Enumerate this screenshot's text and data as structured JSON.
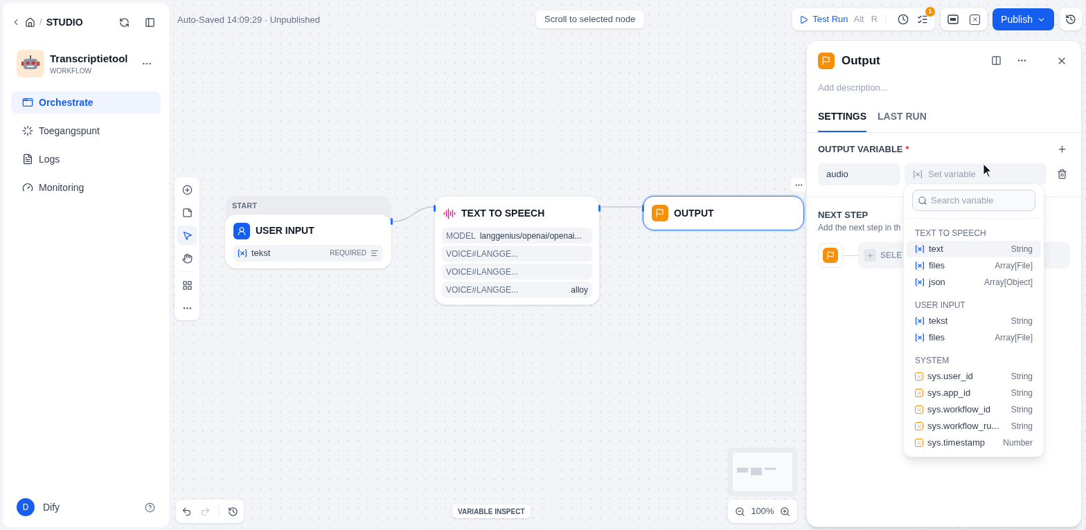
{
  "sidebar": {
    "separator": "/",
    "breadcrumb": "STUDIO",
    "app": {
      "name": "Transcriptietool",
      "type": "WORKFLOW"
    },
    "nav": [
      {
        "kind": "orchestrate",
        "label": "Orchestrate",
        "selected": true
      },
      {
        "kind": "access",
        "label": "Toegangspunt",
        "selected": false
      },
      {
        "kind": "logs",
        "label": "Logs",
        "selected": false
      },
      {
        "kind": "monitoring",
        "label": "Monitoring",
        "selected": false
      }
    ],
    "user": {
      "initial": "D",
      "name": "Dify"
    }
  },
  "topbar": {
    "status": "Auto-Saved 14:09:29 · Unpublished",
    "scroll_button": "Scroll to selected node",
    "test_run": "Test Run",
    "shortcut": [
      "Alt",
      "R"
    ],
    "checklist_badge": "1",
    "publish": "Publish"
  },
  "canvas": {
    "tools": [
      {
        "kind": "add",
        "selected": false
      },
      {
        "kind": "note",
        "selected": false
      },
      {
        "kind": "pointer",
        "selected": true
      },
      {
        "kind": "hand",
        "selected": false
      },
      {
        "kind": "organize",
        "selected": false
      },
      {
        "kind": "more",
        "selected": false
      }
    ],
    "nodes": [
      {
        "kind": "start",
        "header": "START",
        "title": "USER INPUT",
        "selected": false,
        "fields": [
          {
            "name": "tekst",
            "tag": "REQUIRED"
          }
        ]
      },
      {
        "kind": "tts",
        "title": "TEXT TO SPEECH",
        "selected": false,
        "rows": [
          {
            "label": "MODEL",
            "value": "langgenius/openai/openai..."
          },
          {
            "label": "VOICE#LANGGE..."
          },
          {
            "label": "VOICE#LANGGE..."
          },
          {
            "label": "VOICE#LANGGE...",
            "value": "alloy"
          }
        ]
      },
      {
        "kind": "output",
        "title": "OUTPUT",
        "selected": true
      }
    ],
    "variable_inspect": "VARIABLE INSPECT",
    "zoom": "100%"
  },
  "panel": {
    "title": "Output",
    "description_placeholder": "Add description...",
    "tabs": [
      {
        "label": "SETTINGS",
        "selected": true
      },
      {
        "label": "LAST RUN",
        "selected": false
      }
    ],
    "output_variable": {
      "label": "OUTPUT VARIABLE",
      "required_mark": "*",
      "name": "audio",
      "value_placeholder": "Set variable"
    },
    "next_step": {
      "title": "NEXT STEP",
      "hint": "Add the next step in th",
      "button": "SELE"
    }
  },
  "dropdown": {
    "search_placeholder": "Search variable",
    "groups": [
      {
        "title": "TEXT TO SPEECH",
        "items": [
          {
            "kind": "var",
            "name": "text",
            "type": "String",
            "selected": true
          },
          {
            "kind": "var",
            "name": "files",
            "type": "Array[File]",
            "selected": false
          },
          {
            "kind": "var",
            "name": "json",
            "type": "Array[Object]",
            "selected": false
          }
        ]
      },
      {
        "title": "USER INPUT",
        "items": [
          {
            "kind": "var",
            "name": "tekst",
            "type": "String",
            "selected": false
          },
          {
            "kind": "var",
            "name": "files",
            "type": "Array[File]",
            "selected": false
          }
        ]
      },
      {
        "title": "SYSTEM",
        "items": [
          {
            "kind": "sys",
            "name": "sys.user_id",
            "type": "String",
            "selected": false
          },
          {
            "kind": "sys",
            "name": "sys.app_id",
            "type": "String",
            "selected": false
          },
          {
            "kind": "sys",
            "name": "sys.workflow_id",
            "type": "String",
            "selected": false
          },
          {
            "kind": "sys",
            "name": "sys.workflow_ru...",
            "type": "String",
            "selected": false
          },
          {
            "kind": "sys",
            "name": "sys.timestamp",
            "type": "Number",
            "selected": false
          }
        ]
      }
    ]
  }
}
